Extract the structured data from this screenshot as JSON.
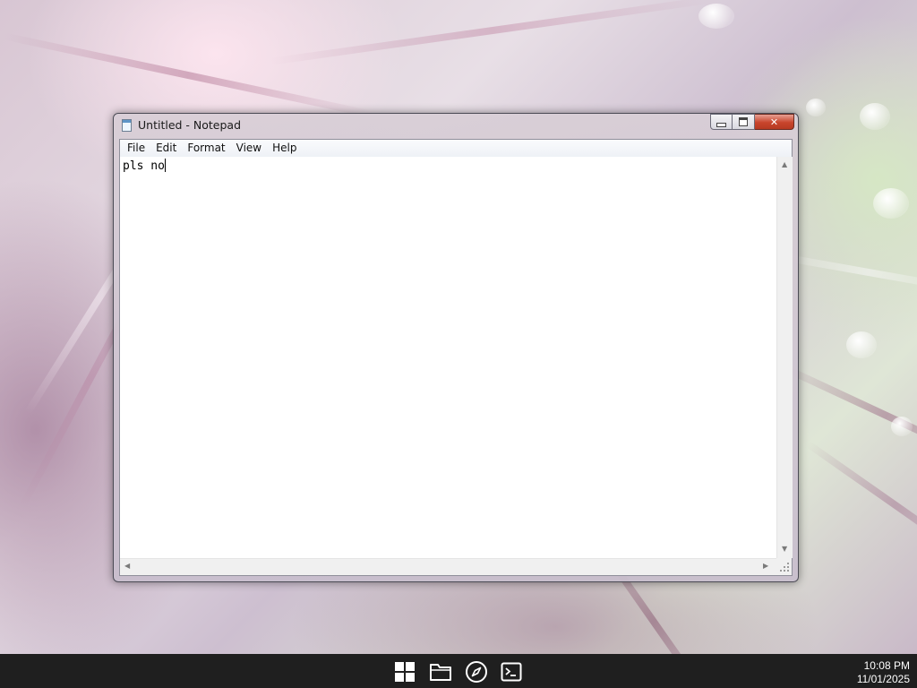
{
  "window": {
    "title": "Untitled - Notepad",
    "app_icon": "notepad-icon",
    "caption_buttons": {
      "minimize": "minimize-icon",
      "maximize": "maximize-icon",
      "close_label": "✕"
    }
  },
  "menu": {
    "items": [
      {
        "label": "File"
      },
      {
        "label": "Edit"
      },
      {
        "label": "Format"
      },
      {
        "label": "View"
      },
      {
        "label": "Help"
      }
    ]
  },
  "editor": {
    "text": "pls no"
  },
  "taskbar": {
    "icons": [
      "windows-start-icon",
      "file-explorer-icon",
      "browser-compass-icon",
      "terminal-icon"
    ],
    "clock": {
      "time": "10:08 PM",
      "date": "11/01/2025"
    }
  },
  "colors": {
    "taskbar": "#1f1f1f",
    "close_button": "#c8442c",
    "editor_bg": "#ffffff"
  }
}
